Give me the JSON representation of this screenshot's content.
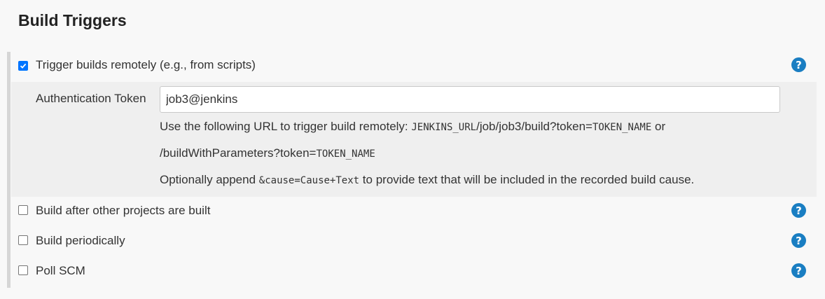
{
  "section": {
    "title": "Build Triggers"
  },
  "triggers": [
    {
      "label": "Trigger builds remotely (e.g., from scripts)",
      "checked": true,
      "help_icon": "question-circle-icon"
    },
    {
      "label": "Build after other projects are built",
      "checked": false,
      "help_icon": "question-circle-icon"
    },
    {
      "label": "Build periodically",
      "checked": false,
      "help_icon": "question-circle-icon"
    },
    {
      "label": "Poll SCM",
      "checked": false,
      "help_icon": "question-circle-icon"
    }
  ],
  "remote": {
    "token_label": "Authentication Token",
    "token_value": "job3@jenkins",
    "help": {
      "line1_prefix": "Use the following URL to trigger build remotely: ",
      "line1_code": "JENKINS_URL",
      "line1_path": "/job/job3/build?token=",
      "line1_code2": "TOKEN_NAME",
      "line1_suffix": " or",
      "line2_path": "/buildWithParameters?token=",
      "line2_code": "TOKEN_NAME",
      "line3_prefix": "Optionally append ",
      "line3_code": "&cause=Cause+Text",
      "line3_suffix": " to provide text that will be included in the recorded build cause."
    }
  },
  "colors": {
    "help_icon": "#1a7ec2",
    "checkbox_checked": "#0075ff",
    "nested_bg": "#efefef",
    "page_bg": "#f8f8f8"
  }
}
